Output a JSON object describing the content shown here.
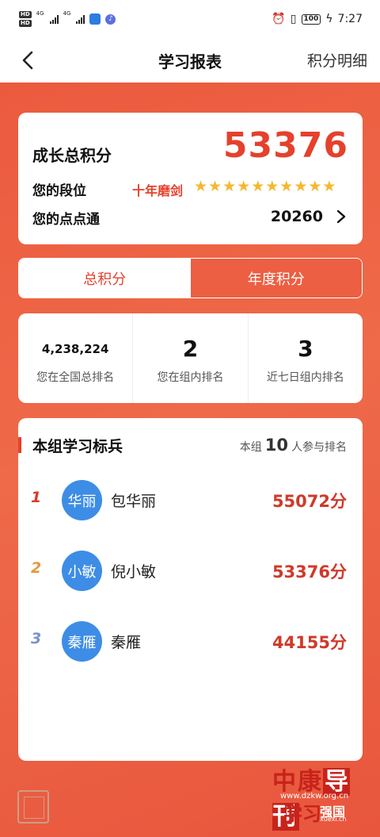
{
  "status_bar": {
    "hd1": "HD",
    "hd2": "HD",
    "net1": "4G",
    "net2": "4G",
    "battery": "100",
    "time": "7:27"
  },
  "header": {
    "title": "学习报表",
    "detail_link": "积分明细"
  },
  "score_card": {
    "title": "成长总积分",
    "total": "53376",
    "rank_label": "您的段位",
    "rank_name": "十年磨剑",
    "stars": 10,
    "points_label": "您的点点通",
    "points_value": "20260"
  },
  "tabs": [
    {
      "label": "总积分",
      "active": true
    },
    {
      "label": "年度积分",
      "active": false
    }
  ],
  "rankings": {
    "national_value": "4,238,224",
    "national_label": "您在全国总排名",
    "group_value": "2",
    "group_label": "您在组内排名",
    "week_value": "3",
    "week_label": "近七日组内排名"
  },
  "leaderboard": {
    "title": "本组学习标兵",
    "meta_prefix": "本组",
    "meta_count": "10",
    "meta_suffix": "人参与排名",
    "rows": [
      {
        "rank": "1",
        "avatar_text": "华丽",
        "name": "包华丽",
        "score": "55072分",
        "rank_color": "#d93a2b"
      },
      {
        "rank": "2",
        "avatar_text": "小敏",
        "name": "倪小敏",
        "score": "53376分",
        "rank_color": "#e39a3c"
      },
      {
        "rank": "3",
        "avatar_text": "秦雁",
        "name": "秦雁",
        "score": "44155分",
        "rank_color": "#7b93c8"
      }
    ]
  },
  "watermark": {
    "brand_top": "中康",
    "brand_box": "导刊",
    "site": "www.dzkw.org.cn",
    "logo_text": "学习",
    "logo_sub": "强国",
    "logo_url": "xuexi.cn"
  },
  "colors": {
    "accent": "#e5412c",
    "background_red": "#ec5a3e",
    "star": "#f5b82e",
    "avatar": "#3d8de6"
  }
}
